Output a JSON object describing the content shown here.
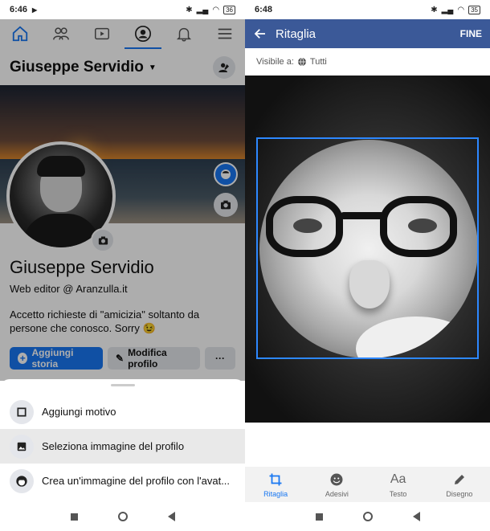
{
  "left": {
    "status": {
      "time": "6:46",
      "battery": "36"
    },
    "profile_name": "Giuseppe Servidio",
    "profile_full_name": "Giuseppe Servidio",
    "job": "Web editor @ Aranzulla.it",
    "bio": "Accetto richieste di \"amicizia\" soltanto da persone che conosco. Sorry 😉",
    "actions": {
      "add_story": "Aggiungi storia",
      "edit_profile": "Modifica profilo",
      "more": "···"
    },
    "sheet": {
      "items": [
        {
          "label": "Aggiungi motivo",
          "icon": "frame-icon"
        },
        {
          "label": "Seleziona immagine del profilo",
          "icon": "photo-icon"
        },
        {
          "label": "Crea un'immagine del profilo con l'avat...",
          "icon": "avatar-icon"
        }
      ]
    }
  },
  "right": {
    "status": {
      "time": "6:48",
      "battery": "35"
    },
    "title": "Ritaglia",
    "done": "FINE",
    "visibility_label": "Visibile a:",
    "visibility_value": "Tutti",
    "tools": [
      {
        "label": "Ritaglia",
        "icon": "crop-icon"
      },
      {
        "label": "Adesivi",
        "icon": "sticker-icon"
      },
      {
        "label": "Testo",
        "glyph": "Aa"
      },
      {
        "label": "Disegno",
        "icon": "pencil-icon"
      }
    ]
  },
  "colors": {
    "accent": "#1877f2",
    "appbar": "#3b5998",
    "crop": "#2d88ff"
  }
}
